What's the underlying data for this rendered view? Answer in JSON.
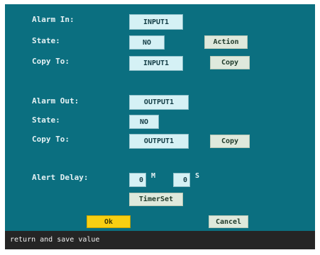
{
  "alarm_in": {
    "label": "Alarm In:",
    "value": "INPUT1",
    "state_label": "State:",
    "state_value": "NO",
    "action_button": "Action",
    "copy_to_label": "Copy To:",
    "copy_to_value": "INPUT1",
    "copy_button": "Copy"
  },
  "alarm_out": {
    "label": "Alarm Out:",
    "value": "OUTPUT1",
    "state_label": "State:",
    "state_value": "NO",
    "copy_to_label": "Copy To:",
    "copy_to_value": "OUTPUT1",
    "copy_button": "Copy"
  },
  "alert_delay": {
    "label": "Alert Delay:",
    "minutes_value": "0",
    "minutes_unit": "M",
    "seconds_value": "0",
    "seconds_unit": "S",
    "timerset_button": "TimerSet"
  },
  "footer": {
    "ok_button": "Ok",
    "cancel_button": "Cancel"
  },
  "status_bar": {
    "text": "return and save value"
  },
  "colors": {
    "panel": "#0b6f80",
    "field": "#d5f1f5",
    "ok": "#f7cf12",
    "status_bar": "#252525"
  }
}
